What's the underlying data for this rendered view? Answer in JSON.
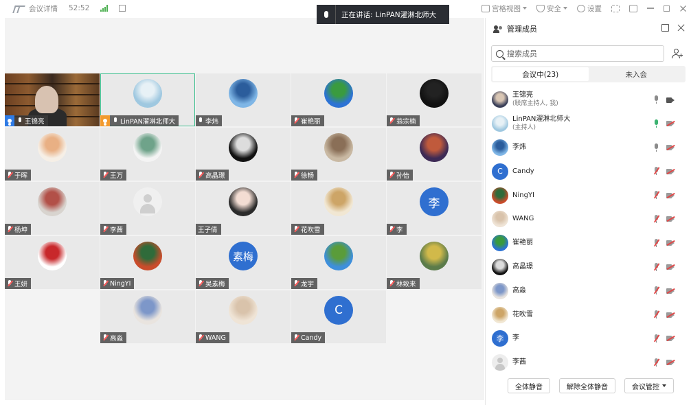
{
  "topbar": {
    "meeting_details": "会议详情",
    "timer": "52:52",
    "gallery_view": "宫格视图",
    "security": "安全",
    "settings": "设置"
  },
  "speaking": {
    "label": "正在讲话:",
    "name": "LinPAN濯淋北师大"
  },
  "grid": {
    "tiles": [
      {
        "name": "王锦亮",
        "kind": "video",
        "host": "blue",
        "mic": "on"
      },
      {
        "name": "LinPAN濯淋北师大",
        "kind": "avatar",
        "host": "orange",
        "mic": "on",
        "active": true,
        "colors": [
          "#9fc8e0",
          "#e7f1f6"
        ]
      },
      {
        "name": "李炜",
        "kind": "avatar",
        "mic": "on",
        "colors": [
          "#7fb6e6",
          "#2b5d9c"
        ]
      },
      {
        "name": "崔艳丽",
        "kind": "avatar",
        "mic": "muted",
        "colors": [
          "#2d73d4",
          "#3a9b3f"
        ]
      },
      {
        "name": "翁宗楠",
        "kind": "avatar",
        "mic": "muted",
        "colors": [
          "#111111",
          "#222222"
        ]
      },
      {
        "name": "于晖",
        "kind": "avatar",
        "mic": "muted",
        "colors": [
          "#f6efe6",
          "#e9b084"
        ]
      },
      {
        "name": "王万",
        "kind": "avatar",
        "mic": "muted",
        "colors": [
          "#f4f4f4",
          "#6fa38a"
        ]
      },
      {
        "name": "高晶璟",
        "kind": "avatar",
        "mic": "muted",
        "colors": [
          "#111111",
          "#dddddd"
        ]
      },
      {
        "name": "徐畅",
        "kind": "avatar",
        "mic": "muted",
        "colors": [
          "#c9b9a3",
          "#8a6f57"
        ]
      },
      {
        "name": "孙怡",
        "kind": "avatar",
        "mic": "muted",
        "colors": [
          "#3d2a55",
          "#c05a3c"
        ]
      },
      {
        "name": "杨坤",
        "kind": "avatar",
        "mic": "muted",
        "colors": [
          "#d8d4cf",
          "#b25048"
        ]
      },
      {
        "name": "李茜",
        "kind": "ghost",
        "mic": "muted"
      },
      {
        "name": "王子倩",
        "kind": "avatar",
        "mic": "none",
        "colors": [
          "#2b2b2b",
          "#f3ddd3"
        ]
      },
      {
        "name": "花吹雪",
        "kind": "avatar",
        "mic": "muted",
        "colors": [
          "#f1e7d3",
          "#cda567"
        ]
      },
      {
        "name": "李",
        "kind": "letter",
        "letter": "李",
        "mic": "muted"
      },
      {
        "name": "王妍",
        "kind": "avatar",
        "mic": "muted",
        "colors": [
          "#ffffff",
          "#c8282b"
        ]
      },
      {
        "name": "NingYI",
        "kind": "avatar",
        "mic": "muted",
        "colors": [
          "#c94c2b",
          "#2f6b3a"
        ]
      },
      {
        "name": "吴素梅",
        "kind": "letter",
        "letter": "素梅",
        "mic": "muted"
      },
      {
        "name": "龙宇",
        "kind": "avatar",
        "mic": "muted",
        "colors": [
          "#3e8fdb",
          "#5a9c3a"
        ]
      },
      {
        "name": "林致来",
        "kind": "avatar",
        "mic": "muted",
        "colors": [
          "#5b7b4a",
          "#d1b94a"
        ]
      },
      {
        "name": "",
        "kind": "empty"
      },
      {
        "name": "高淼",
        "kind": "avatar",
        "mic": "muted",
        "colors": [
          "#e9e4df",
          "#7d97c9"
        ]
      },
      {
        "name": "WANG",
        "kind": "avatar",
        "mic": "muted",
        "colors": [
          "#efe4d6",
          "#d9c3ab"
        ]
      },
      {
        "name": "Candy",
        "kind": "letter",
        "letter": "C",
        "mic": "muted"
      },
      {
        "name": "",
        "kind": "empty"
      }
    ]
  },
  "panel": {
    "title": "管理成员",
    "search_placeholder": "搜索成员",
    "tab_in_meeting": "会议中(23)",
    "tab_not_joined": "未入会",
    "members": [
      {
        "name": "王锦亮",
        "sub": "(联席主持人, 我)",
        "av": "img",
        "colors": [
          "#3a3f58",
          "#d9c6b4"
        ],
        "mic": "on-gray",
        "video": "on"
      },
      {
        "name": "LinPAN濯淋北师大",
        "sub": "(主持人)",
        "av": "img",
        "colors": [
          "#9fc8e0",
          "#e7f1f6"
        ],
        "mic": "on-green",
        "video": "off"
      },
      {
        "name": "李炜",
        "sub": "",
        "av": "img",
        "colors": [
          "#7fb6e6",
          "#2b5d9c"
        ],
        "mic": "on-gray",
        "video": "off"
      },
      {
        "name": "Candy",
        "sub": "",
        "av": "letter",
        "letter": "C",
        "mic": "muted",
        "video": "off"
      },
      {
        "name": "NingYI",
        "sub": "",
        "av": "img",
        "colors": [
          "#c94c2b",
          "#2f6b3a"
        ],
        "mic": "muted",
        "video": "off"
      },
      {
        "name": "WANG",
        "sub": "",
        "av": "img",
        "colors": [
          "#efe4d6",
          "#d9c3ab"
        ],
        "mic": "muted",
        "video": "off"
      },
      {
        "name": "崔艳丽",
        "sub": "",
        "av": "img",
        "colors": [
          "#2d73d4",
          "#3a9b3f"
        ],
        "mic": "muted",
        "video": "off"
      },
      {
        "name": "高晶璟",
        "sub": "",
        "av": "img",
        "colors": [
          "#111111",
          "#dddddd"
        ],
        "mic": "muted",
        "video": "off"
      },
      {
        "name": "高淼",
        "sub": "",
        "av": "img",
        "colors": [
          "#e9e4df",
          "#7d97c9"
        ],
        "mic": "muted",
        "video": "off"
      },
      {
        "name": "花吹雪",
        "sub": "",
        "av": "img",
        "colors": [
          "#f1e7d3",
          "#cda567"
        ],
        "mic": "muted",
        "video": "off"
      },
      {
        "name": "李",
        "sub": "",
        "av": "letter",
        "letter": "李",
        "mic": "muted",
        "video": "off"
      },
      {
        "name": "李茜",
        "sub": "",
        "av": "ghost",
        "mic": "muted",
        "video": "off"
      }
    ],
    "btn_mute_all": "全体静音",
    "btn_unmute_all": "解除全体静音",
    "btn_controls": "会议管控"
  },
  "colors": {
    "accent": "#2f6fd0",
    "active_border": "#3dbf8f",
    "mic_on": "#3cb371",
    "muted": "#e04848"
  }
}
